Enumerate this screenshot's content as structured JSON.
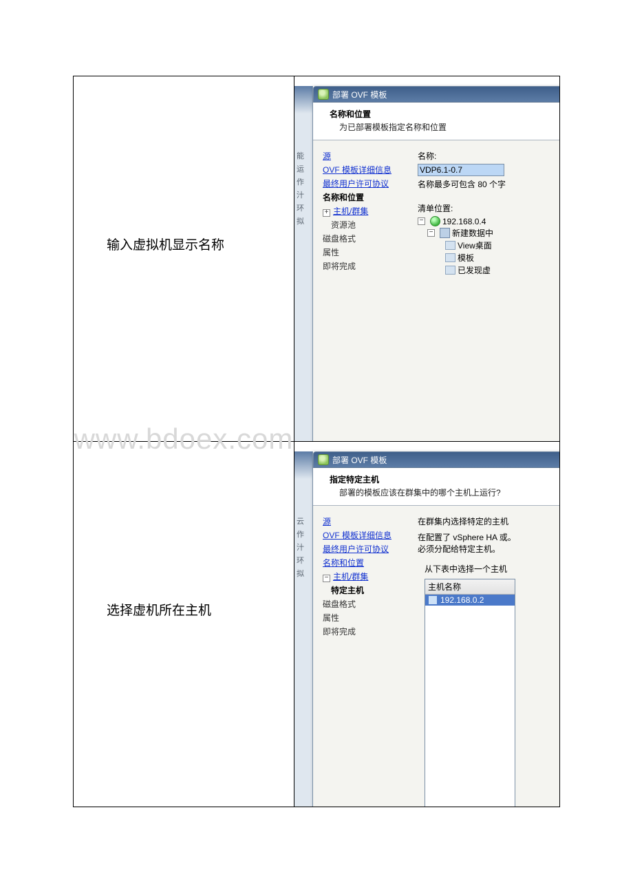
{
  "watermark": "www.bdoex.com",
  "rows": [
    {
      "left_label": "输入虚拟机显示名称",
      "bg_strip": [
        "能",
        "",
        "运",
        "作",
        "",
        "汁",
        "环",
        "",
        "拟"
      ],
      "titlebar": "部署 OVF 模板",
      "header_title": "名称和位置",
      "header_sub": "为已部署模板指定名称和位置",
      "steps": {
        "s0": "源",
        "s1": "OVF 模板详细信息",
        "s2": "最终用户许可协议",
        "s3": "名称和位置",
        "s4": "主机/群集",
        "s4a": "资源池",
        "s5": "磁盘格式",
        "s6": "属性",
        "s7": "即将完成"
      },
      "right": {
        "name_label": "名称:",
        "name_value": "VDP6.1-0.7",
        "name_hint": "名称最多可包含 80 个字",
        "inventory_label": "清单位置:",
        "tree_root": "192.168.0.4",
        "tree_dc": "新建数据中",
        "leaf1": "View桌面",
        "leaf2": "模板",
        "leaf3": "已发现虚"
      }
    },
    {
      "left_label": "选择虚机所在主机",
      "bg_strip": [
        "云",
        "作",
        "",
        "汁",
        "环",
        "",
        "拟"
      ],
      "titlebar": "部署 OVF 模板",
      "header_title": "指定特定主机",
      "header_sub": "部署的模板应该在群集中的哪个主机上运行?",
      "steps": {
        "s0": "源",
        "s1": "OVF 模板详细信息",
        "s2": "最终用户许可协议",
        "s3": "名称和位置",
        "s4": "主机/群集",
        "s4b": "特定主机",
        "s5": "磁盘格式",
        "s6": "属性",
        "s7": "即将完成"
      },
      "right": {
        "info1": "在群集内选择特定的主机",
        "info2": "在配置了 vSphere HA 或。",
        "info3": "必须分配给特定主机。",
        "info4": "从下表中选择一个主机",
        "host_col": "主机名称",
        "host_row": "192.168.0.2"
      }
    }
  ]
}
